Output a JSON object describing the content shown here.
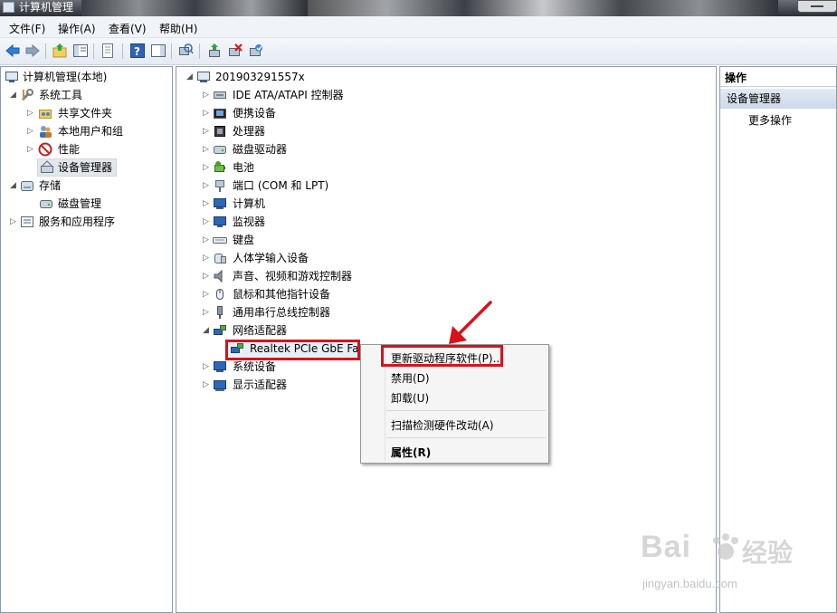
{
  "window": {
    "title": "计算机管理"
  },
  "menu": [
    "文件(F)",
    "操作(A)",
    "查看(V)",
    "帮助(H)"
  ],
  "left_tree": {
    "root": "计算机管理(本地)",
    "items": [
      "系统工具",
      "共享文件夹",
      "本地用户和组",
      "性能",
      "设备管理器",
      "存储",
      "磁盘管理",
      "服务和应用程序"
    ]
  },
  "device_tree": {
    "computer": "201903291557x",
    "categories": [
      "IDE ATA/ATAPI 控制器",
      "便携设备",
      "处理器",
      "磁盘驱动器",
      "电池",
      "端口 (COM 和 LPT)",
      "计算机",
      "监视器",
      "键盘",
      "人体学输入设备",
      "声音、视频和游戏控制器",
      "鼠标和其他指针设备",
      "通用串行总线控制器",
      "网络适配器"
    ],
    "selected_device": "Realtek PCIe GbE Fa",
    "after": [
      "系统设备",
      "显示适配器"
    ]
  },
  "context_menu": {
    "update": "更新驱动程序软件(P)...",
    "disable": "禁用(D)",
    "uninstall": "卸载(U)",
    "scan": "扫描检测硬件改动(A)",
    "properties": "属性(R)"
  },
  "actions": {
    "header": "操作",
    "selected": "设备管理器",
    "more": "更多操作"
  },
  "watermark": {
    "brand": "Bai",
    "brand2": "经验",
    "url": "jingyan.baidu.com"
  },
  "colors": {
    "highlight_red": "#d8121a",
    "selected_blue": "#cdd9e8"
  }
}
